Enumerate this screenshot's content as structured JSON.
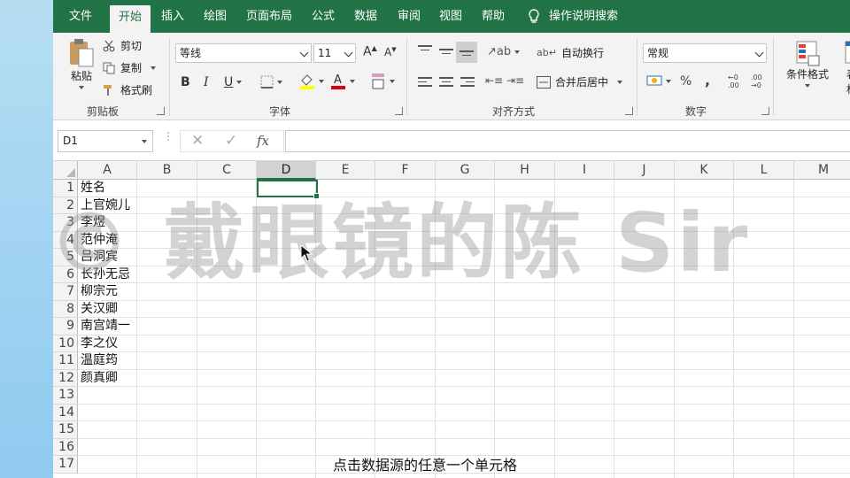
{
  "ribbon_tabs": [
    "文件",
    "开始",
    "插入",
    "绘图",
    "页面布局",
    "公式",
    "数据",
    "审阅",
    "视图",
    "帮助"
  ],
  "active_tab": "开始",
  "tell_me": "操作说明搜索",
  "clipboard": {
    "paste": "粘贴",
    "cut": "剪切",
    "copy": "复制",
    "format_painter": "格式刷",
    "group_label": "剪贴板"
  },
  "font": {
    "name": "等线",
    "size": "11",
    "bold": "B",
    "italic": "I",
    "underline": "U",
    "group_label": "字体"
  },
  "alignment": {
    "wrap_text": "自动换行",
    "merge_center": "合并后居中",
    "group_label": "对齐方式"
  },
  "number": {
    "format": "常规",
    "percent": "%",
    "comma": ",",
    "group_label": "数字"
  },
  "styles": {
    "conditional_format": "条件格式",
    "table_format_partial": "表格"
  },
  "formula_bar": {
    "name_box": "D1",
    "fx": "fx",
    "value": ""
  },
  "columns": [
    "A",
    "B",
    "C",
    "D",
    "E",
    "F",
    "G",
    "H",
    "I",
    "J",
    "K",
    "L",
    "M"
  ],
  "selected_column": "D",
  "row_numbers": [
    "1",
    "2",
    "3",
    "4",
    "5",
    "6",
    "7",
    "8",
    "9",
    "10",
    "11",
    "12",
    "13",
    "14",
    "15",
    "16",
    "17"
  ],
  "column_a": [
    "姓名",
    "上官婉儿",
    "李煜",
    "范仲淹",
    "吕洞宾",
    "长孙无忌",
    "柳宗元",
    "关汉卿",
    "南宫靖一",
    "李之仪",
    "温庭筠",
    "颜真卿"
  ],
  "watermark": "© 戴眼镜的陈 Sir",
  "subtitle": "点击数据源的任意一个单元格",
  "colors": {
    "excel_green": "#217346",
    "ribbon_bg": "#f3f3f3",
    "desktop": "#9fd0ee"
  }
}
